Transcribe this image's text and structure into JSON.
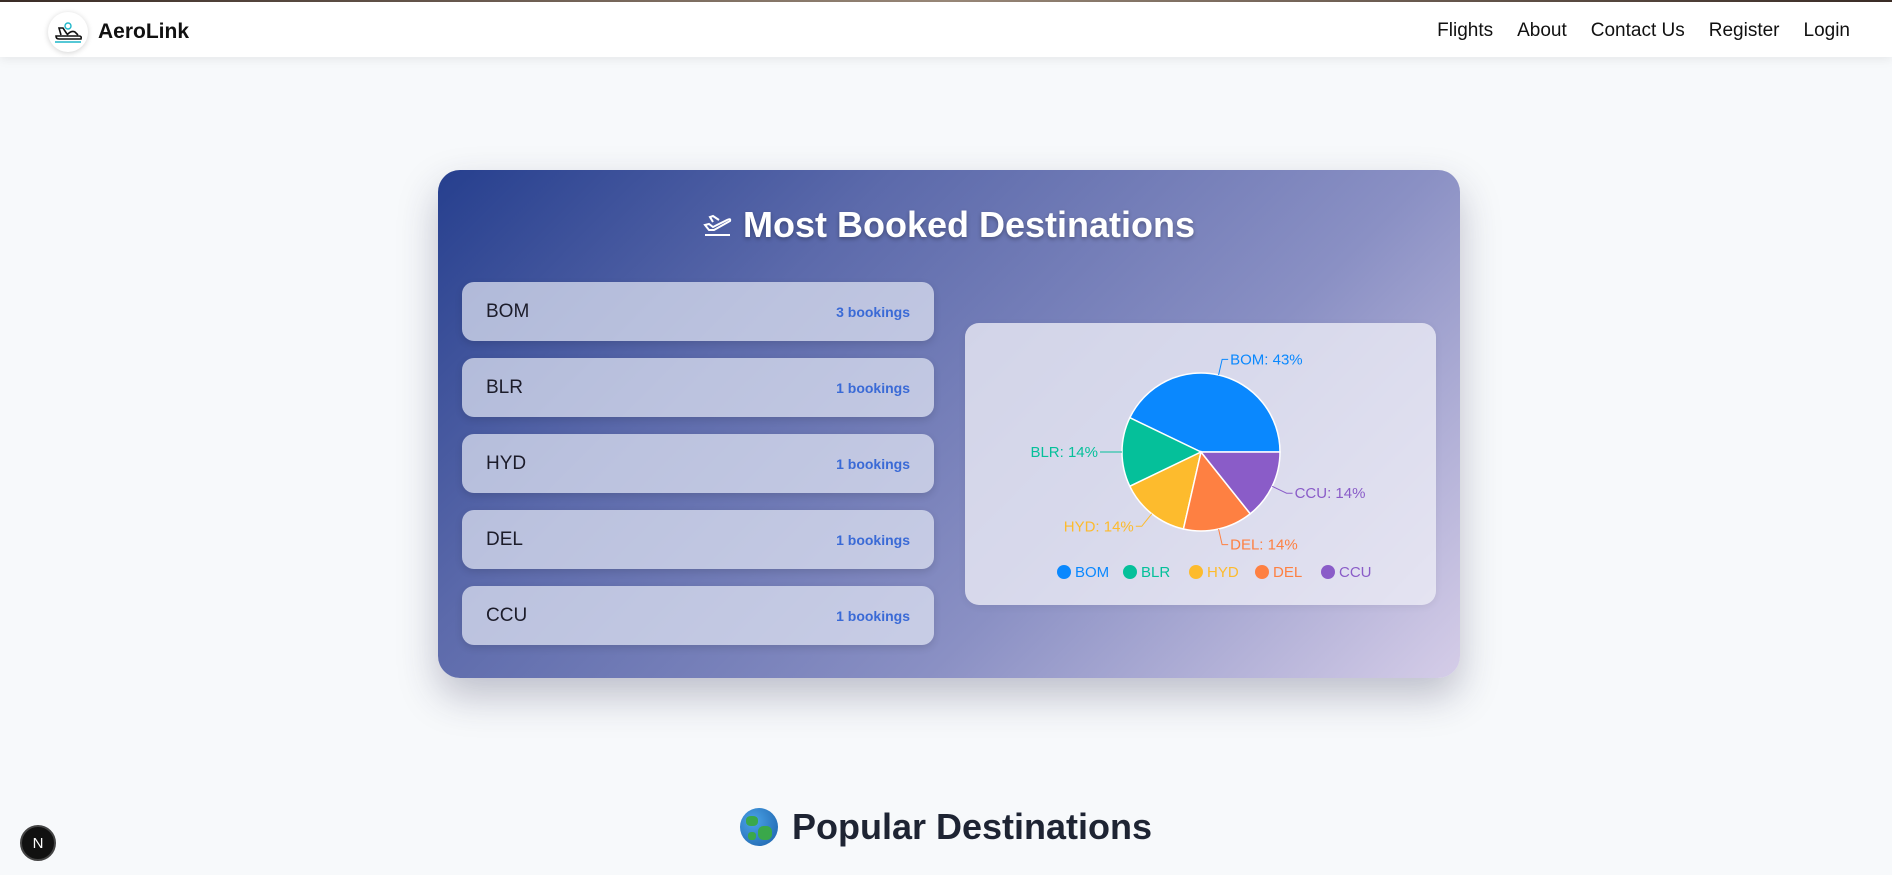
{
  "navbar": {
    "brand": "AeroLink",
    "links": [
      "Flights",
      "About",
      "Contact Us",
      "Register",
      "Login"
    ]
  },
  "card": {
    "title": "Most Booked Destinations",
    "destinations": [
      {
        "code": "BOM",
        "count": "3 bookings"
      },
      {
        "code": "BLR",
        "count": "1 bookings"
      },
      {
        "code": "HYD",
        "count": "1 bookings"
      },
      {
        "code": "DEL",
        "count": "1 bookings"
      },
      {
        "code": "CCU",
        "count": "1 bookings"
      }
    ]
  },
  "chart_data": {
    "type": "pie",
    "categories": [
      "BOM",
      "BLR",
      "HYD",
      "DEL",
      "CCU"
    ],
    "values": [
      3,
      1,
      1,
      1,
      1
    ],
    "labels": [
      "BOM: 43%",
      "BLR: 14%",
      "HYD: 14%",
      "DEL: 14%",
      "CCU: 14%"
    ],
    "colors": [
      "#0a88fe",
      "#05c09a",
      "#fdbb2d",
      "#fe8042",
      "#8a5cc8"
    ],
    "legend_position": "bottom"
  },
  "popular": {
    "title": "Popular Destinations"
  },
  "dev_badge": "N"
}
